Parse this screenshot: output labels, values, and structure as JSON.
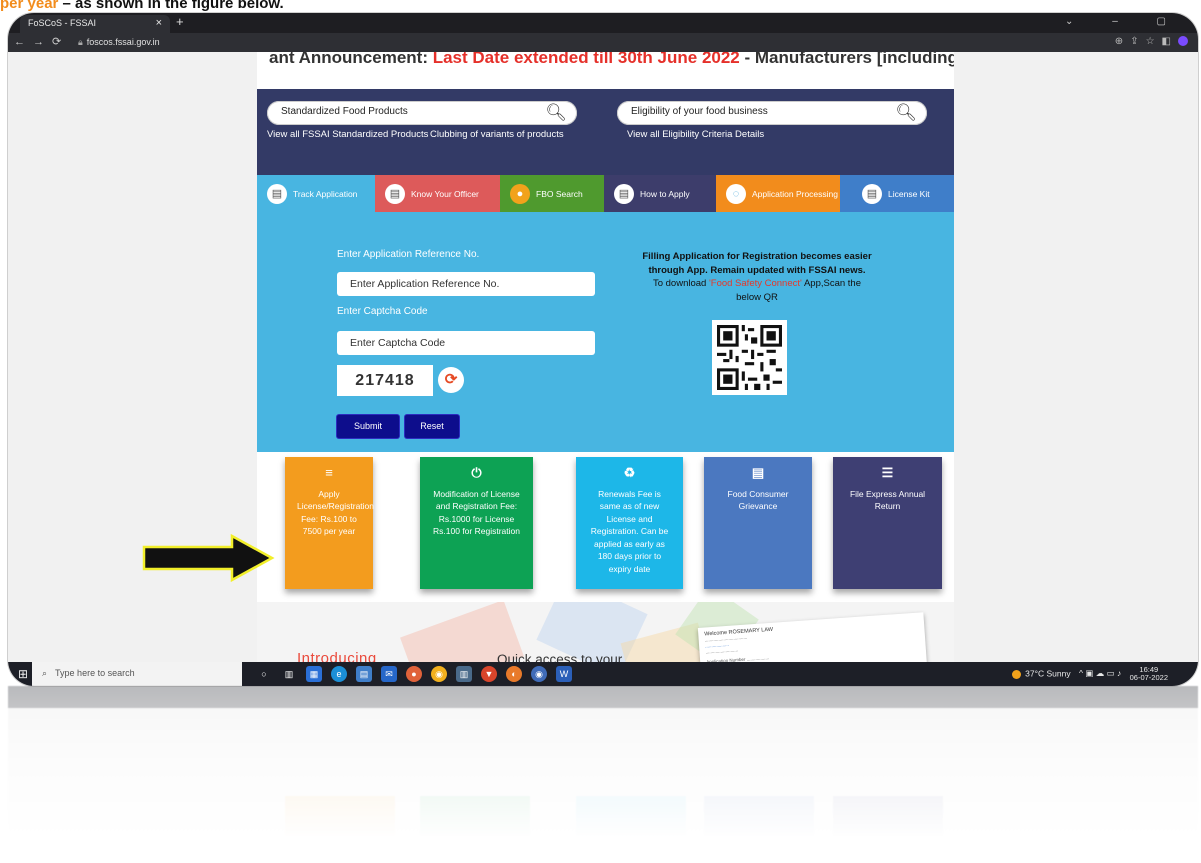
{
  "caption": {
    "highlight": "per year",
    "rest": " – as shown in the figure below."
  },
  "browser": {
    "tab_title": "FoSCoS - FSSAI",
    "tab_close": "×",
    "new_tab": "+",
    "url": "foscos.fssai.gov.in"
  },
  "page": {
    "announcement_prefix": "ant Announcement: ",
    "announcement_red": "Last Date extended till 30th June 2022",
    "announcement_suffix": " - Manufacturers [including Repackers an",
    "search_left": {
      "placeholder": "Standardized Food Products",
      "link1": "View all FSSAI Standardized Products",
      "link2": "Clubbing of variants of products"
    },
    "search_right": {
      "placeholder": "Eligibility of your food business",
      "link1": "View all Eligibility Criteria Details"
    },
    "tabs": [
      {
        "label": "Track Application",
        "color": "#48b5e1",
        "icon": "document-search-icon"
      },
      {
        "label": "Know Your Officer",
        "color": "#dd5a5a",
        "icon": "officer-icon"
      },
      {
        "label": "FBO Search",
        "color": "#4f9a2e",
        "icon": "fbo-search-icon"
      },
      {
        "label": "How to Apply",
        "color": "#3d3d6b",
        "icon": "how-to-apply-icon"
      },
      {
        "label": "Application Processing",
        "color": "#f28c1c",
        "icon": "processing-icon"
      },
      {
        "label": "License Kit",
        "color": "#3f7ec9",
        "icon": "license-kit-icon"
      }
    ],
    "form": {
      "ref_label": "Enter Application Reference No.",
      "ref_placeholder": "Enter Application Reference No.",
      "captcha_label": "Enter Captcha Code",
      "captcha_placeholder": "Enter Captcha Code",
      "captcha_value": "217418",
      "submit": "Submit",
      "reset": "Reset"
    },
    "app_info": {
      "line1": "Filling Application for Registration becomes easier through App. Remain updated with FSSAI news.",
      "line2_prefix": "To download ",
      "app_name": "'Food Safety Connect'",
      "line2_suffix": " App,Scan the below QR"
    },
    "tiles": [
      {
        "icon": "≡",
        "icon_name": "list-icon",
        "text": "Apply License/Registration Fee: Rs.100 to 7500 per year",
        "color": "#f39c1e"
      },
      {
        "icon": "⏻",
        "icon_name": "plug-icon",
        "text": "Modification of License and Registration Fee: Rs.1000 for License Rs.100 for Registration",
        "color": "#0da254"
      },
      {
        "icon": "♻",
        "icon_name": "recycle-icon",
        "text": "Renewals Fee is same as of new License and Registration. Can be applied as early as 180 days prior to expiry date",
        "color": "#1db7e8"
      },
      {
        "icon": "▤",
        "icon_name": "id-card-icon",
        "text": "Food Consumer Grievance",
        "color": "#4b78c0"
      },
      {
        "icon": "☰",
        "icon_name": "align-left-icon",
        "text": "File Express Annual Return",
        "color": "#3e3f73"
      }
    ],
    "lower": {
      "introducing": "Introducing",
      "quick_access": "Quick access to your"
    }
  },
  "taskbar": {
    "search_placeholder": "Type here to search",
    "weather": "37°C  Sunny",
    "time": "16:49",
    "date": "06-07-2022"
  }
}
